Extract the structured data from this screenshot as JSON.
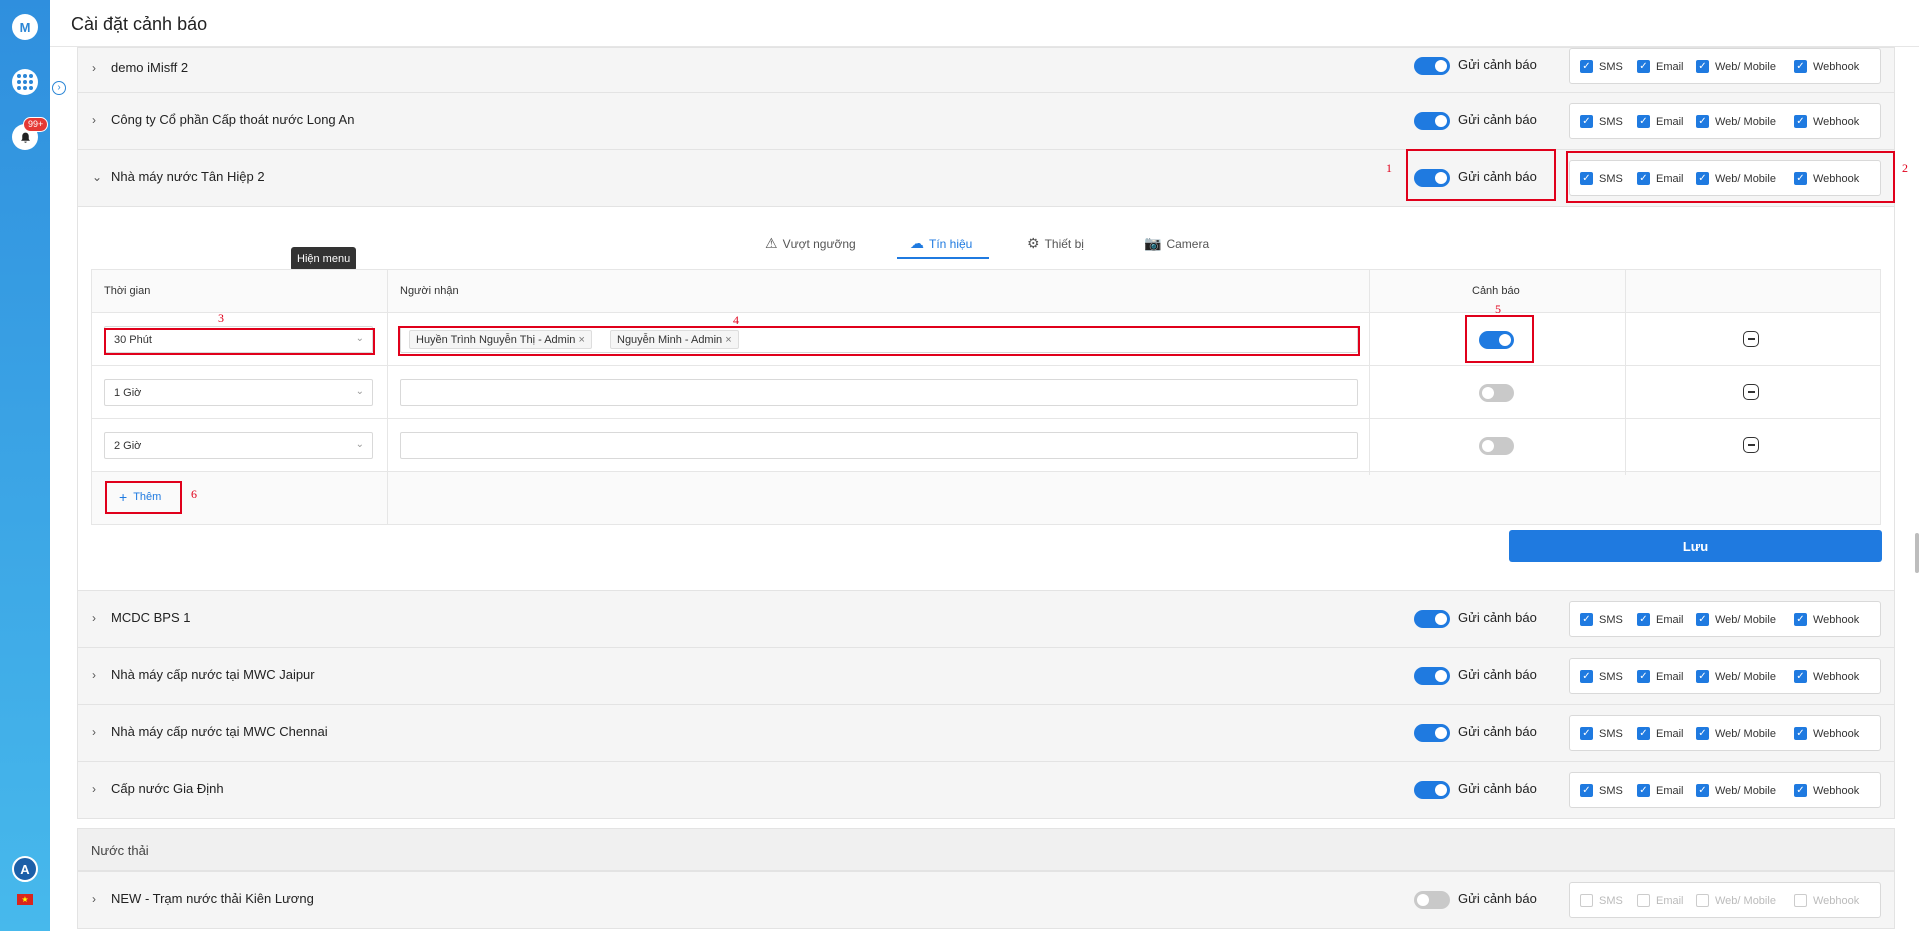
{
  "header": {
    "title": "Cài đặt cảnh báo"
  },
  "sidebar": {
    "badge": "99+",
    "avatar": "A",
    "logo": "M"
  },
  "channels": [
    "SMS",
    "Email",
    "Web/ Mobile",
    "Webhook"
  ],
  "send_label": "Gửi cảnh báo",
  "rows_top": [
    {
      "name": "demo iMisff 2",
      "enabled": true
    },
    {
      "name": "Công ty Cổ phần Cấp thoát nước Long An",
      "enabled": true
    }
  ],
  "expanded": {
    "name": "Nhà máy nước Tân Hiệp 2",
    "tabs": [
      {
        "label": "Vượt ngưỡng",
        "icon": "warning-icon"
      },
      {
        "label": "Tín hiệu",
        "icon": "cloud-icon",
        "active": true
      },
      {
        "label": "Thiết bị",
        "icon": "device-icon"
      },
      {
        "label": "Camera",
        "icon": "camera-icon"
      }
    ],
    "tooltip": "Hiện menu",
    "table": {
      "col_time": "Thời gian",
      "col_receiver": "Người nhận",
      "col_alert": "Cảnh báo",
      "rows": [
        {
          "time": "30 Phút",
          "receivers": [
            "Huyền Trình Nguyễn Thị - Admin",
            "Nguyễn Minh - Admin"
          ],
          "on": true
        },
        {
          "time": "1 Giờ",
          "receivers": [],
          "on": false
        },
        {
          "time": "2 Giờ",
          "receivers": [],
          "on": false
        }
      ],
      "add_label": "Thêm"
    },
    "save_label": "Lưu"
  },
  "rows_bottom": [
    {
      "name": "MCDC BPS 1",
      "enabled": true
    },
    {
      "name": "Nhà máy cấp nước tại MWC Jaipur",
      "enabled": true
    },
    {
      "name": "Nhà máy cấp nước tại MWC Chennai",
      "enabled": true
    },
    {
      "name": "Cấp nước Gia Định",
      "enabled": true
    }
  ],
  "group_label": "Nước thải",
  "row_last": {
    "name": "NEW - Trạm nước thải Kiên Lương",
    "enabled": false
  },
  "annotations": [
    "1",
    "2",
    "3",
    "4",
    "5",
    "6"
  ]
}
